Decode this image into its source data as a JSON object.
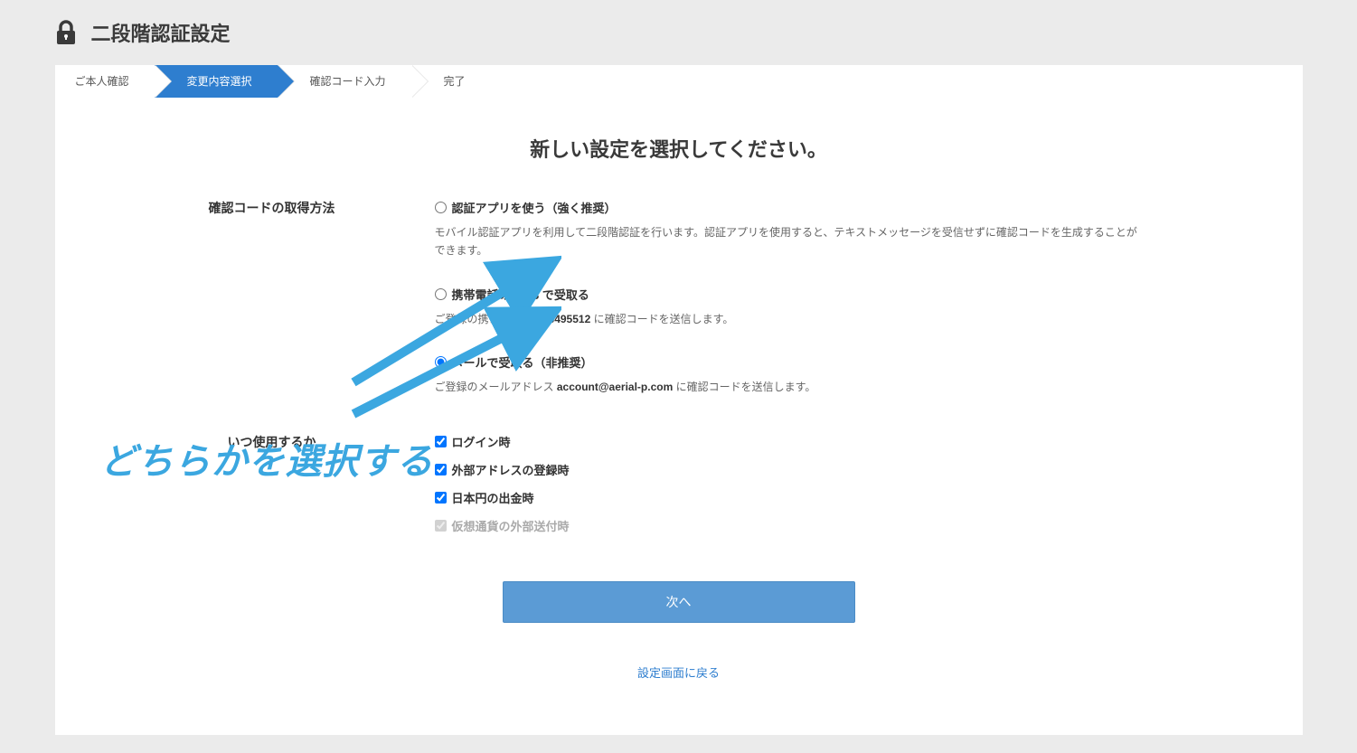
{
  "header": {
    "title": "二段階認証設定"
  },
  "wizard": {
    "step1": "ご本人確認",
    "step2": "変更内容選択",
    "step3": "確認コード入力",
    "step4": "完了"
  },
  "main": {
    "heading": "新しい設定を選択してください。",
    "section1_label": "確認コードの取得方法",
    "section2_label": "いつ使用するか",
    "radio_app": {
      "label": "認証アプリを使う（強く推奨）",
      "desc": "モバイル認証アプリを利用して二段階認証を行います。認証アプリを使用すると、テキストメッセージを受信せずに確認コードを生成することができます。"
    },
    "radio_sms": {
      "label": "携帯電話の SMS で受取る",
      "desc_pre": "ご登録の携帯電話 ",
      "desc_phone": "07033495512",
      "desc_post": " に確認コードを送信します。"
    },
    "radio_email": {
      "label": "メールで受取る（非推奨）",
      "desc_pre": "ご登録のメールアドレス ",
      "desc_email": "account@aerial-p.com",
      "desc_post": " に確認コードを送信します。"
    },
    "check_login": "ログイン時",
    "check_address": "外部アドレスの登録時",
    "check_jpy": "日本円の出金時",
    "check_crypto": "仮想通貨の外部送付時",
    "next_button": "次へ",
    "back_link": "設定画面に戻る"
  },
  "annotation": {
    "text": "どちらかを選択する"
  }
}
